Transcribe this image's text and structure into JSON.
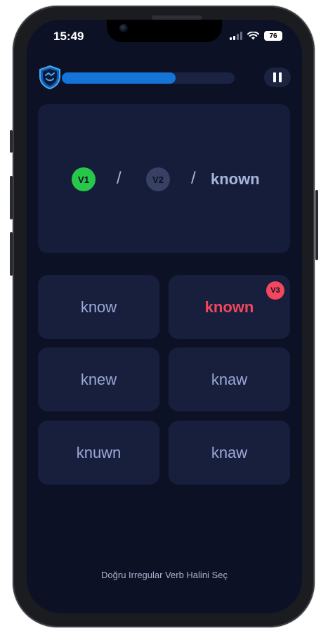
{
  "status_bar": {
    "time": "15:49",
    "battery": "76"
  },
  "progress": {
    "fraction": 0.66,
    "fill_color": "#1474d8"
  },
  "question": {
    "v1_label": "V1",
    "v2_label": "V2",
    "separator": "/",
    "answer": "known"
  },
  "options": [
    {
      "label": "know"
    },
    {
      "label": "known",
      "badge": "V3",
      "selected": true
    },
    {
      "label": "knew"
    },
    {
      "label": "knaw"
    },
    {
      "label": "knuwn"
    },
    {
      "label": "knaw"
    }
  ],
  "instruction": "Doğru Irregular Verb Halini Seç",
  "colors": {
    "background": "#0d1126",
    "card": "#161d3a",
    "v1": "#27c74a",
    "v2": "#384063",
    "correct": "#f2475d"
  },
  "icons": {
    "logo": "shield-icon",
    "pause": "pause-icon"
  }
}
